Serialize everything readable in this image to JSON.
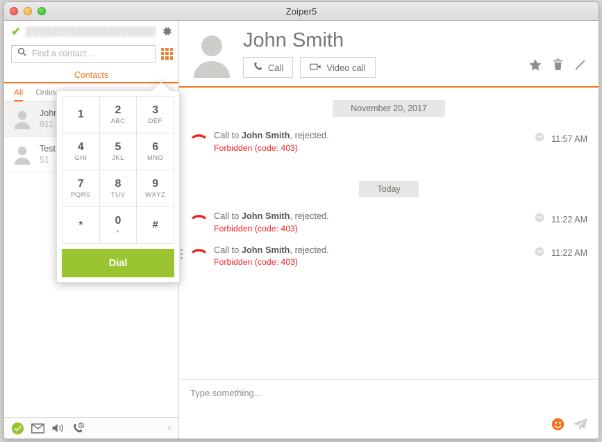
{
  "window": {
    "title": "Zoiper5",
    "traffic_lights": [
      "close",
      "minimize",
      "maximize"
    ]
  },
  "sidebar": {
    "account": {
      "status_icon": "check-icon",
      "value_redacted": "",
      "settings_icon": "gear-icon"
    },
    "search": {
      "icon": "search-icon",
      "value": "",
      "placeholder": "Find a contact ..",
      "dialpad_toggle_icon": "grid-icon"
    },
    "main_tab": "Contacts",
    "subtabs": [
      {
        "label": "All",
        "active": true
      },
      {
        "label": "Online",
        "active": false
      }
    ],
    "contacts": [
      {
        "name": "John Smith",
        "number": "911",
        "selected": true,
        "avatar_icon": "user-avatar-icon"
      },
      {
        "name": "Test",
        "number": "51",
        "selected": false,
        "avatar_icon": "user-avatar-icon"
      }
    ],
    "statusbar": {
      "icons": [
        "status-available-icon",
        "voicemail-icon",
        "speaker-icon",
        "call-history-icon"
      ],
      "collapse_icon": "chevron-left-icon"
    }
  },
  "dialpad": {
    "visible": true,
    "keys": [
      {
        "digit": "1",
        "letters": ""
      },
      {
        "digit": "2",
        "letters": "ABC"
      },
      {
        "digit": "3",
        "letters": "DEF"
      },
      {
        "digit": "4",
        "letters": "GHI"
      },
      {
        "digit": "5",
        "letters": "JKL"
      },
      {
        "digit": "6",
        "letters": "MNO"
      },
      {
        "digit": "7",
        "letters": "PQRS"
      },
      {
        "digit": "8",
        "letters": "TUV"
      },
      {
        "digit": "9",
        "letters": "WXYZ"
      },
      {
        "digit": "*",
        "letters": ""
      },
      {
        "digit": "0",
        "letters": "+"
      },
      {
        "digit": "#",
        "letters": ""
      }
    ],
    "dial_label": "Dial",
    "dial_color": "#9ac430"
  },
  "contact_header": {
    "avatar_icon": "user-avatar-icon",
    "name": "John Smith",
    "call_button": {
      "label": "Call",
      "icon": "phone-icon"
    },
    "video_button": {
      "label": "Video call",
      "icon": "video-camera-icon"
    },
    "tools": [
      "star-icon",
      "trash-icon",
      "pencil-icon"
    ],
    "accent_color": "#ef7622"
  },
  "conversation": {
    "groups": [
      {
        "date_label": "November 20, 2017",
        "entries": [
          {
            "icon": "call-rejected-icon",
            "prefix": "Call to ",
            "contact": "John Smith",
            "suffix": ", rejected.",
            "error": "Forbidden (code: 403)",
            "meta_icon": "chevron-down-circle-icon",
            "time": "11:57 AM"
          }
        ]
      },
      {
        "date_label": "Today",
        "entries": [
          {
            "icon": "call-rejected-icon",
            "prefix": "Call to ",
            "contact": "John Smith",
            "suffix": ", rejected.",
            "error": "Forbidden (code: 403)",
            "meta_icon": "chevron-down-circle-icon",
            "time": "11:22 AM"
          },
          {
            "icon": "call-rejected-icon",
            "prefix": "Call to ",
            "contact": "John Smith",
            "suffix": ", rejected.",
            "error": "Forbidden (code: 403)",
            "meta_icon": "chevron-down-circle-icon",
            "time": "11:22 AM"
          }
        ]
      }
    ],
    "error_color": "#ee2222"
  },
  "composer": {
    "value": "",
    "placeholder": "Type something...",
    "emoji_icon": "smiley-icon",
    "send_icon": "send-paper-plane-icon",
    "emoji_color": "#ef7622"
  }
}
